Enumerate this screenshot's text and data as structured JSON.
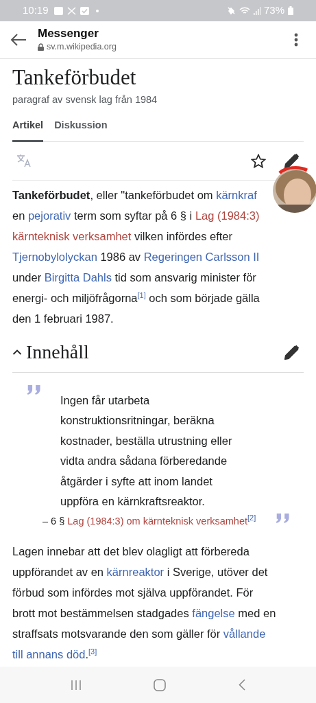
{
  "status_bar": {
    "time": "10:19",
    "battery": "73%"
  },
  "browser_bar": {
    "title": "Messenger",
    "url": "sv.m.wikipedia.org"
  },
  "page": {
    "title": "Tankeförbudet",
    "description": "paragraf av svensk lag från 1984"
  },
  "tabs": [
    {
      "label": "Artikel",
      "selected": true
    },
    {
      "label": "Diskussion",
      "selected": false
    }
  ],
  "intro": [
    [
      {
        "kind": "bold",
        "text": "Tankeförbudet"
      },
      {
        "kind": "plain",
        "text": ", eller \"tankeförbudet om "
      },
      {
        "kind": "link",
        "text": "kärnkraf"
      }
    ],
    [
      {
        "kind": "plain",
        "text": "en "
      },
      {
        "kind": "link",
        "text": "pejorativ"
      },
      {
        "kind": "plain",
        "text": " term som syftar på 6 § i "
      },
      {
        "kind": "redlink",
        "text": "Lag (1984:3)"
      }
    ],
    [
      {
        "kind": "redlink",
        "text": "kärnteknisk verksamhet"
      },
      {
        "kind": "plain",
        "text": " vilken infördes efter"
      }
    ],
    [
      {
        "kind": "link",
        "text": "Tjernobylolyckan"
      },
      {
        "kind": "plain",
        "text": " 1986 av "
      },
      {
        "kind": "link",
        "text": "Regeringen Carlsson II"
      }
    ],
    [
      {
        "kind": "plain",
        "text": "under "
      },
      {
        "kind": "link",
        "text": "Birgitta Dahls"
      },
      {
        "kind": "plain",
        "text": " tid som ansvarig minister för"
      }
    ],
    [
      {
        "kind": "plain",
        "text": "energi- och miljöfrågorna"
      },
      {
        "kind": "ref",
        "text": "[1]"
      },
      {
        "kind": "plain",
        "text": " och som började gälla"
      }
    ],
    [
      {
        "kind": "plain",
        "text": "den 1 februari 1987."
      }
    ]
  ],
  "section": {
    "title": "Innehåll",
    "expanded": true
  },
  "quote": {
    "lines": [
      "Ingen får utarbeta",
      "konstruktionsritningar, beräkna",
      "kostnader, beställa utrustning eller",
      "vidta andra sådana förberedande",
      "åtgärder i syfte att inom landet",
      "uppföra en kärnkraftsreaktor."
    ],
    "source": [
      {
        "kind": "plain",
        "text": "– 6 § "
      },
      {
        "kind": "redlink",
        "text": "Lag (1984:3) om kärnteknisk verksamhet"
      },
      {
        "kind": "ref",
        "text": "[2]"
      }
    ]
  },
  "body": [
    [
      {
        "kind": "plain",
        "text": "Lagen innebar att det blev olagligt att förbereda"
      }
    ],
    [
      {
        "kind": "plain",
        "text": "uppförandet av en "
      },
      {
        "kind": "link",
        "text": "kärnreaktor"
      },
      {
        "kind": "plain",
        "text": " i Sverige, utöver det"
      }
    ],
    [
      {
        "kind": "plain",
        "text": "förbud som infördes mot själva uppförandet. För"
      }
    ],
    [
      {
        "kind": "plain",
        "text": "brott mot bestämmelsen stadgades "
      },
      {
        "kind": "link",
        "text": "fängelse"
      },
      {
        "kind": "plain",
        "text": " med en"
      }
    ],
    [
      {
        "kind": "plain",
        "text": "straffsats motsvarande den som gäller för "
      },
      {
        "kind": "link",
        "text": "vållande"
      }
    ],
    [
      {
        "kind": "link",
        "text": "till annans död"
      },
      {
        "kind": "plain",
        "text": "."
      },
      {
        "kind": "ref",
        "text": "[3]"
      }
    ]
  ]
}
